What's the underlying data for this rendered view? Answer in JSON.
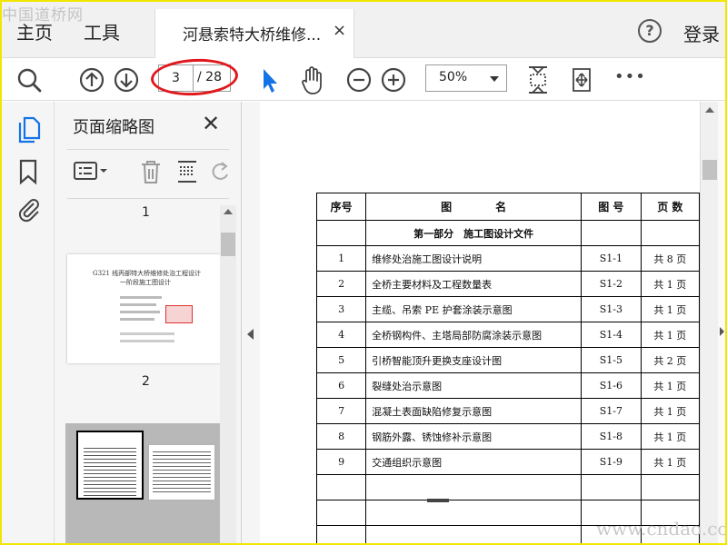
{
  "watermark": {
    "top": "中国道桥网",
    "bottom": "www.cndao.com"
  },
  "menubar": {
    "home": "主页",
    "tools": "工具",
    "doc_tab_title": "河悬索特大桥维修...",
    "doc_tab_close": "×",
    "help": "?",
    "login": "登录"
  },
  "toolbar": {
    "current_page": "3",
    "total_pages": "/ 28",
    "zoom": "50%",
    "more": "•••"
  },
  "thumbnails": {
    "title": "页面缩略图",
    "close": "✕",
    "page_numbers": [
      "1",
      "2"
    ],
    "page2_lines": [
      "G321 线丙部特大桥维修处治工程设计",
      "一阶段施工图设计"
    ]
  },
  "document": {
    "headers": [
      "序号",
      "图　　　　名",
      "图 号",
      "页 数"
    ],
    "section": "第一部分　施工图设计文件",
    "rows": [
      {
        "no": "1",
        "name": "维修处治施工图设计说明",
        "code": "S1-1",
        "pages": "共 8 页"
      },
      {
        "no": "2",
        "name": "全桥主要材料及工程数量表",
        "code": "S1-2",
        "pages": "共 1 页"
      },
      {
        "no": "3",
        "name": "主缆、吊索 PE 护套涂装示意图",
        "code": "S1-3",
        "pages": "共 1 页"
      },
      {
        "no": "4",
        "name": "全桥钢构件、主塔局部防腐涂装示意图",
        "code": "S1-4",
        "pages": "共 1 页"
      },
      {
        "no": "5",
        "name": "引桥智能顶升更换支座设计图",
        "code": "S1-5",
        "pages": "共 2 页"
      },
      {
        "no": "6",
        "name": "裂缝处治示意图",
        "code": "S1-6",
        "pages": "共 1 页"
      },
      {
        "no": "7",
        "name": "混凝土表面缺陷修复示意图",
        "code": "S1-7",
        "pages": "共 1 页"
      },
      {
        "no": "8",
        "name": "钢筋外露、锈蚀修补示意图",
        "code": "S1-8",
        "pages": "共 1 页"
      },
      {
        "no": "9",
        "name": "交通组织示意图",
        "code": "S1-9",
        "pages": "共 1 页"
      }
    ]
  },
  "colors": {
    "accent": "#1473e6",
    "highlight": "#e0181e",
    "frame": "#f2e600"
  }
}
